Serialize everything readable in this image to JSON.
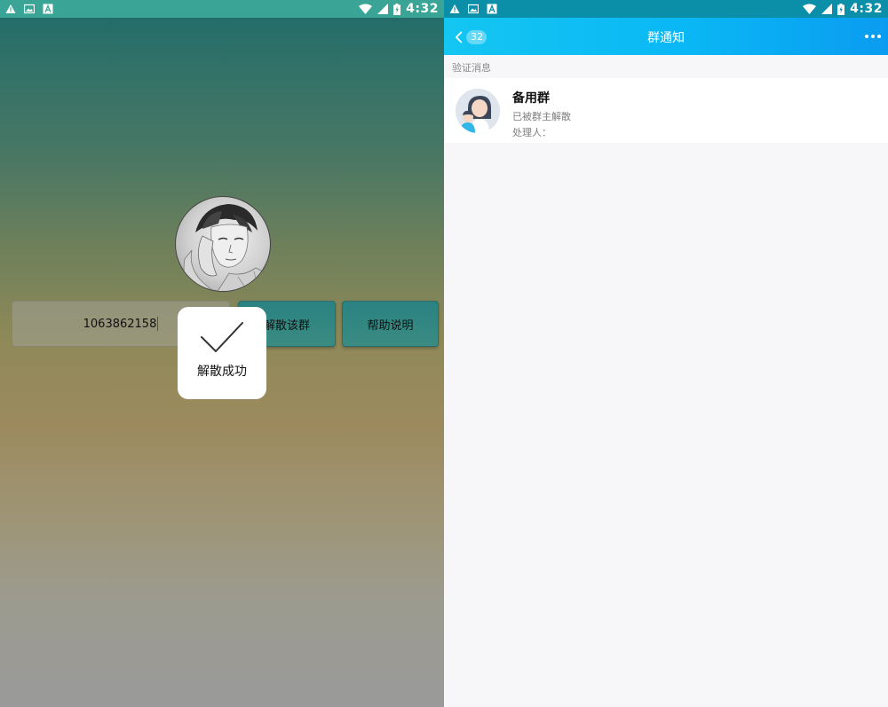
{
  "status_bar": {
    "time": "4:32"
  },
  "left_app": {
    "qq_number_value": "1063862158",
    "dismiss_button_label": "解散该群",
    "help_button_label": "帮助说明",
    "toast_text": "解散成功"
  },
  "right_app": {
    "nav": {
      "back_badge": "32",
      "title": "群通知"
    },
    "section_label": "验证消息",
    "notice": {
      "group_name": "备用群",
      "status": "已被群主解散",
      "handler_label": "处理人："
    }
  },
  "colors": {
    "left_statusbar": "#3aa596",
    "right_statusbar": "#0b8ea8",
    "nav_gradient_start": "#14c6f2",
    "nav_gradient_end": "#0a9cf0",
    "button_teal": "#2a8282"
  },
  "icons": [
    "warning-icon",
    "image-icon",
    "font-icon",
    "wifi-icon",
    "signal-icon",
    "battery-icon",
    "back-chevron-icon",
    "more-icon",
    "check-icon"
  ]
}
